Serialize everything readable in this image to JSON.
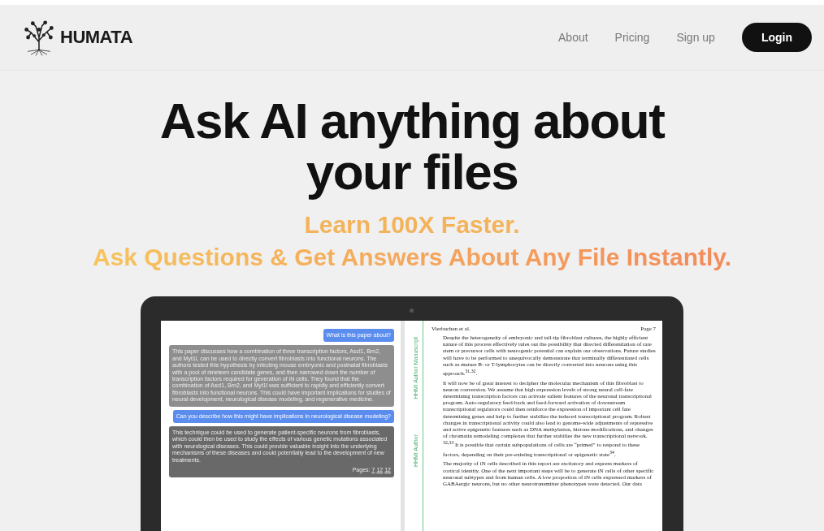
{
  "header": {
    "logo_text": "HUMATA",
    "nav": [
      "About",
      "Pricing",
      "Sign up"
    ],
    "login": "Login"
  },
  "hero": {
    "title_lines": [
      "Ask AI anything about",
      "your files"
    ],
    "subtitle_lines": [
      "Learn 100X Faster.",
      "Ask Questions & Get Answers About Any File Instantly."
    ]
  },
  "chat": {
    "messages": [
      {
        "kind": "question",
        "text": "What is this paper about?"
      },
      {
        "kind": "answer",
        "text": "This paper discusses how a combination of three transcription factors, Ascl1, Brn2, and Myt1l, can be used to directly convert fibroblasts into functional neurons. The authors tested this hypothesis by infecting mouse embryonic and postnatal fibroblasts with a pool of nineteen candidate genes, and then narrowed down the number of transcription factors required for generation of iN cells. They found that the combination of Ascl1, Brn2, and Myt1l was sufficient to rapidly and efficiently convert fibroblasts into functional neurons. This could have important implications for studies of neural development, neurological disease modeling, and regenerative medicine."
      },
      {
        "kind": "question",
        "text": "Can you describe how this might have implications in neurological disease modeling?"
      },
      {
        "kind": "answer_latest",
        "text": "This technique could be used to generate patient-specific neurons from fibroblasts, which could then be used to study the effects of various genetic mutations associated with neurological diseases. This could provide valuable insight into the underlying mechanisms of these diseases and could potentially lead to the development of new treatments.",
        "pages_label": "Pages:",
        "pages": [
          "7",
          "12",
          "12"
        ]
      }
    ]
  },
  "document": {
    "margin_labels": [
      "HHMI Author Manuscript",
      "HHMI Author"
    ],
    "running_head": "Vierbuchen et al.",
    "page_number": "Page 7",
    "paragraphs": [
      "Despite the heterogeneity of embryonic and tail-tip fibroblast cultures, the highly efficient nature of this process effectively rules out the possibility that directed differentiation of rare stem or precursor cells with neurogenic potential can explain our observations. Future studies will have to be performed to unequivocally demonstrate that terminally differentiated cells such as mature B- or T-lymphocytes can be directly converted into neurons using this approach.$^{31,32}$.",
      "It will now be of great interest to decipher the molecular mechanism of this fibroblast to neuron conversion. We assume that high expression levels of strong neural cell-fate determining transcription factors can activate salient features of the neuronal transcriptional program. Auto-regulatory feed-back and feed-forward activation of downstream transcriptional regulators could then reinforce the expression of important cell fate determining genes and help to further stabilize the induced transcriptional program. Robust changes in transcriptional activity could also lead to genome-wide adjustments of repressive and active epigenetic features such as DNA methylation, histone modifications, and changes of chromatin remodeling complexes that further stabilize the new transcriptional network. $^{32,33}$ It is possible that certain subpopulations of cells are “primed” to respond to these factors, depending on their pre-existing transcriptional or epigenetic state$^{34}$.",
      "The majority of iN cells described in this report are excitatory and express markers of cortical identity. One of the next important steps will be to generate iN cells of other specific neuronal subtypes and from human cells. A low proportion of iN cells expressed markers of GABAergic neurons, but no other neurotransmitter phenotypes were detected. Our data"
    ]
  }
}
